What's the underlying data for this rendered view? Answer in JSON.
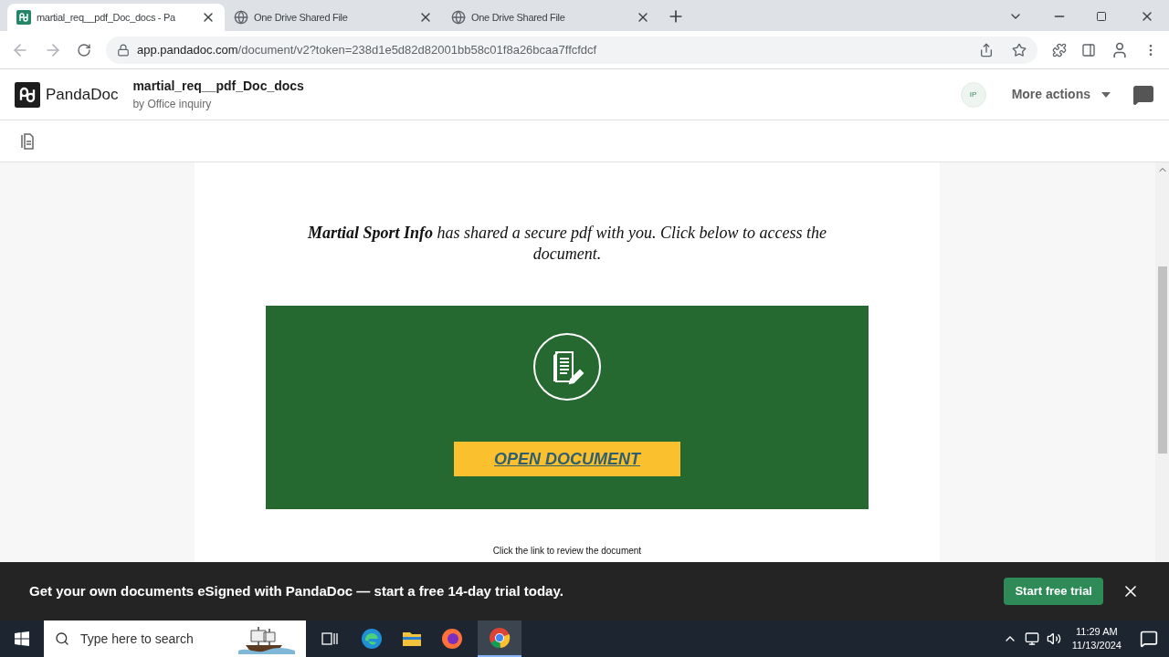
{
  "browser": {
    "tabs": [
      {
        "title": "martial_req__pdf_Doc_docs - Pa",
        "selected": true,
        "kind": "pandadoc"
      },
      {
        "title": "One Drive Shared File",
        "selected": false,
        "kind": "globe"
      },
      {
        "title": "One Drive Shared File",
        "selected": false,
        "kind": "globe"
      }
    ],
    "address": {
      "domain": "app.pandadoc.com",
      "path": "/document/v2?token=238d1e5d82d82001bb58c01f8a26bcaa7ffcfdcf"
    }
  },
  "header": {
    "logo": "PandaDoc",
    "document_title": "martial_req__pdf_Doc_docs",
    "byline": "by Office inquiry",
    "avatar": "IP",
    "more_actions": "More actions"
  },
  "document": {
    "message": "**Martial Sport Info** has shared a secure pdf with you. Click below to access the document.",
    "button": "OPEN DOCUMENT",
    "footnote": "Click the link to review the document"
  },
  "banner": {
    "text": "Get your own documents eSigned with PandaDoc — start a free 14-day trial today.",
    "button": "Start free trial"
  },
  "taskbar": {
    "search_placeholder": "Type here to search",
    "time": "11:29 AM",
    "date": "11/13/2024"
  }
}
